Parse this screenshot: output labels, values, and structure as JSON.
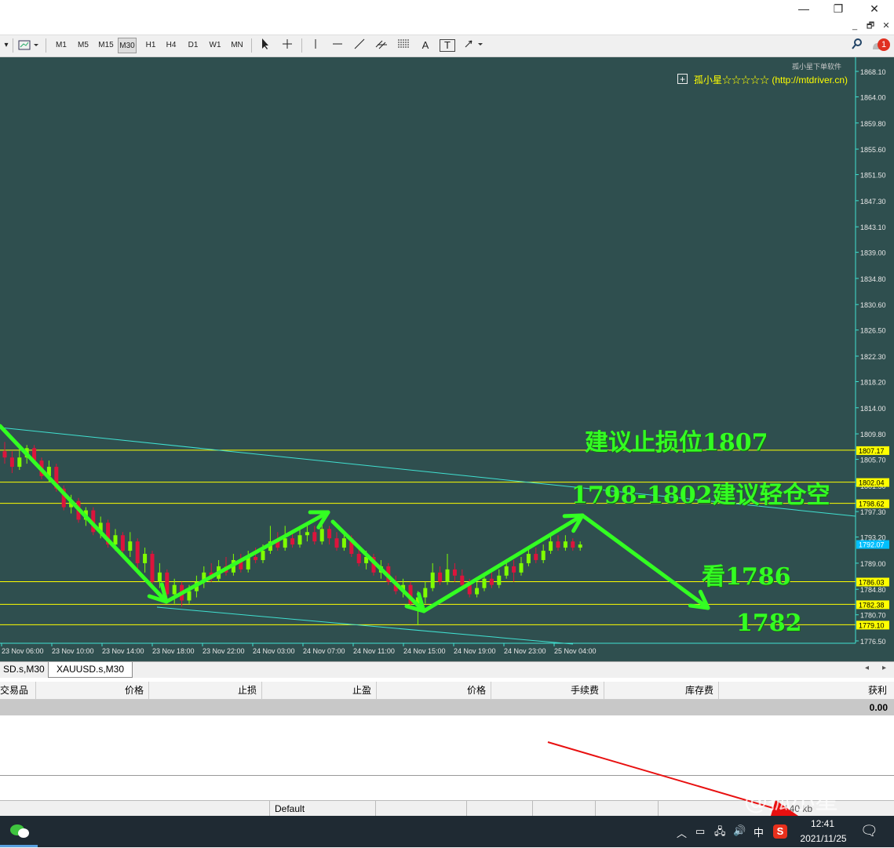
{
  "window": {
    "minimize": "—",
    "restore": "❐",
    "close": "✕"
  },
  "mdi": {
    "minimize": "_",
    "restore": "🗗",
    "close": "✕"
  },
  "toolbar": {
    "timeframes": [
      "M1",
      "M5",
      "M15",
      "M30",
      "H1",
      "H4",
      "D1",
      "W1",
      "MN"
    ],
    "selected_timeframe": "M30",
    "text_tool": "A",
    "label_tool": "T",
    "notification_count": "1"
  },
  "chart_header": {
    "caption": "孤小星下单软件",
    "watermark": "孤小星☆☆☆☆☆ (http://mtdriver.cn)",
    "plus": "+"
  },
  "price_axis": {
    "ticks": [
      "1868.10",
      "1864.00",
      "1859.80",
      "1855.60",
      "1851.50",
      "1847.30",
      "1843.10",
      "1839.00",
      "1834.80",
      "1830.60",
      "1826.50",
      "1822.30",
      "1818.20",
      "1814.00",
      "1809.80",
      "1805.70",
      "1801.50",
      "1797.30",
      "1793.20",
      "1789.00",
      "1784.80",
      "1780.70",
      "1776.50"
    ],
    "level_labels": [
      "1807.17",
      "1802.04",
      "1798.62",
      "1792.07",
      "1786.03",
      "1782.38",
      "1779.10"
    ]
  },
  "time_axis": [
    "23 Nov 06:00",
    "23 Nov 10:00",
    "23 Nov 14:00",
    "23 Nov 18:00",
    "23 Nov 22:00",
    "24 Nov 03:00",
    "24 Nov 07:00",
    "24 Nov 11:00",
    "24 Nov 15:00",
    "24 Nov 19:00",
    "24 Nov 23:00",
    "25 Nov 04:00"
  ],
  "annotations": {
    "stop_loss": "建议止损位1807",
    "short_zone": "1798-1802建议轻仓空",
    "target1": "看1786",
    "target2": "1782"
  },
  "tabs": [
    "SD.s,M30",
    "XAUUSD.s,M30"
  ],
  "terminal": {
    "columns": [
      "交易品种",
      "价格",
      "止损",
      "止盈",
      "价格",
      "手续费",
      "库存费",
      "获利"
    ],
    "total": "0.00"
  },
  "statusbar": {
    "profile": "Default",
    "conn": "/ 40 kb"
  },
  "taskbar": {
    "time": "12:41",
    "date": "2021/11/25",
    "ime": "中",
    "weibo": "@孤小星"
  },
  "colors": {
    "chart_bg": "#2f4f4f",
    "bull": "#7fff00",
    "bear": "#dc143c",
    "level": "#ffff00",
    "channel": "#40e0d0",
    "arrow": "#33ff22",
    "price_tag": "#00bfff"
  },
  "chart_data": {
    "type": "candlestick",
    "symbol": "XAUUSD.s",
    "timeframe": "M30",
    "ylim": [
      1776.5,
      1868.1
    ],
    "horizontal_levels": [
      1807.17,
      1802.04,
      1798.62,
      1786.03,
      1782.38,
      1779.1
    ],
    "current_price": 1792.07
  }
}
